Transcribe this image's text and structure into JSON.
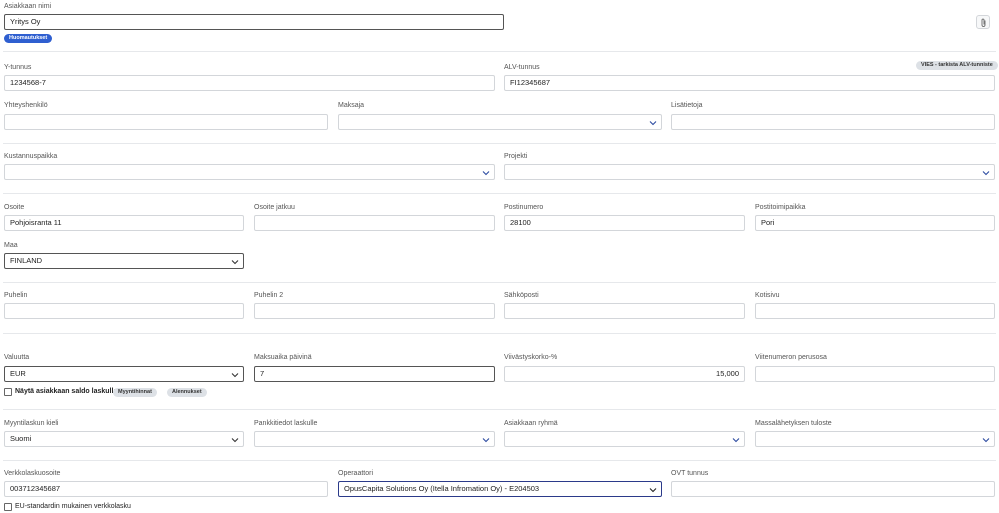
{
  "customer_name": {
    "label": "Asiakkaan nimi",
    "value": "Yritys Oy",
    "notes_badge": "Huomautukset",
    "attach_icon": "paperclip-icon"
  },
  "business_id": {
    "label": "Y-tunnus",
    "value": "1234568-7"
  },
  "vat_id": {
    "label": "ALV-tunnus",
    "value": "FI12345687",
    "vies_button": "VIES - tarkista ALV-tunniste"
  },
  "contact_person": {
    "label": "Yhteyshenkilö",
    "value": ""
  },
  "payer": {
    "label": "Maksaja",
    "value": ""
  },
  "additional_info": {
    "label": "Lisätietoja",
    "value": ""
  },
  "cost_center": {
    "label": "Kustannuspaikka",
    "value": ""
  },
  "project": {
    "label": "Projekti",
    "value": ""
  },
  "address": {
    "label": "Osoite",
    "value": "Pohjoisranta 11"
  },
  "address_cont": {
    "label": "Osoite jatkuu",
    "value": ""
  },
  "postal_code": {
    "label": "Postinumero",
    "value": "28100"
  },
  "postal_city": {
    "label": "Postitoimipaikka",
    "value": "Pori"
  },
  "country": {
    "label": "Maa",
    "value": "FINLAND"
  },
  "phone": {
    "label": "Puhelin",
    "value": ""
  },
  "phone2": {
    "label": "Puhelin 2",
    "value": ""
  },
  "email": {
    "label": "Sähköposti",
    "value": ""
  },
  "homepage": {
    "label": "Kotisivu",
    "value": ""
  },
  "currency": {
    "label": "Valuutta",
    "value": "EUR"
  },
  "payment_days": {
    "label": "Maksuaika päivinä",
    "value": "7"
  },
  "interest": {
    "label": "Viivästyskorko-%",
    "value": "15,000"
  },
  "reference_base": {
    "label": "Viitenumeron perusosa",
    "value": ""
  },
  "show_balance": {
    "label": "Näytä asiakkaan saldo laskulla",
    "checked": false,
    "sales_prices_button": "Myyntihinnat",
    "discounts_button": "Alennukset"
  },
  "invoice_language": {
    "label": "Myyntilaskun kieli",
    "value": "Suomi"
  },
  "bank_details": {
    "label": "Pankkitiedot laskulle",
    "value": ""
  },
  "customer_group": {
    "label": "Asiakkaan ryhmä",
    "value": ""
  },
  "mass_print": {
    "label": "Massalähetyksen tuloste",
    "value": ""
  },
  "einvoice_address": {
    "label": "Verkkolaskuosoite",
    "value": "003712345687"
  },
  "operator": {
    "label": "Operaattori",
    "value": "OpusCapita Solutions Oy (Itella Infromation Oy) - E204503"
  },
  "ovt": {
    "label": "OVT tunnus",
    "value": ""
  },
  "eu_einvoice": {
    "label": "EU-standardin mukainen verkkolasku",
    "checked": false
  },
  "colors": {
    "accent": "#2f5fd0",
    "chevron": "#2b4aa0",
    "border": "#d3d6da"
  }
}
